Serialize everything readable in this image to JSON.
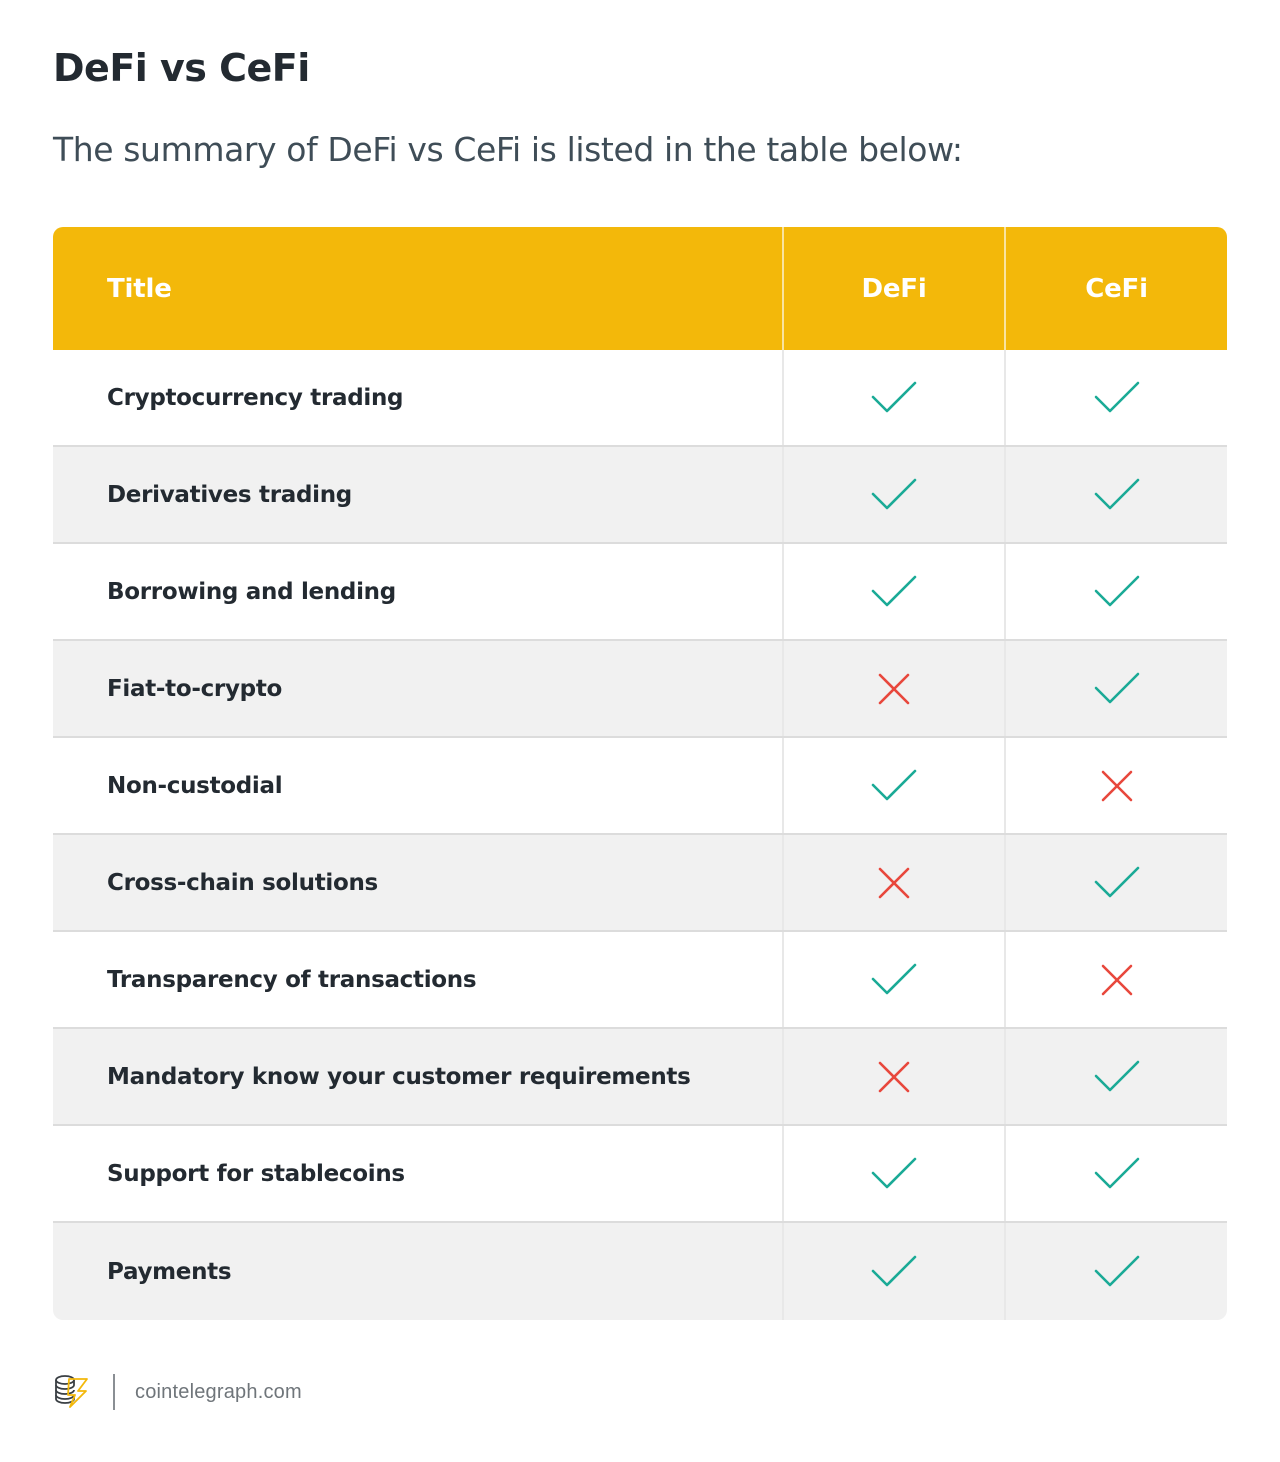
{
  "page": {
    "title": "DeFi vs CeFi",
    "subtitle": "The summary of DeFi vs CeFi is listed in the table below:"
  },
  "table": {
    "header": {
      "title": "Title",
      "defi": "DeFi",
      "cefi": "CeFi"
    },
    "rows": [
      {
        "title": "Cryptocurrency trading",
        "defi": "check",
        "cefi": "check"
      },
      {
        "title": "Derivatives trading",
        "defi": "check",
        "cefi": "check"
      },
      {
        "title": "Borrowing and lending",
        "defi": "check",
        "cefi": "check"
      },
      {
        "title": "Fiat-to-crypto",
        "defi": "cross",
        "cefi": "check"
      },
      {
        "title": "Non-custodial",
        "defi": "check",
        "cefi": "cross"
      },
      {
        "title": "Cross-chain solutions",
        "defi": "cross",
        "cefi": "check"
      },
      {
        "title": "Transparency of transactions",
        "defi": "check",
        "cefi": "cross"
      },
      {
        "title": "Mandatory know your customer requirements",
        "defi": "cross",
        "cefi": "check"
      },
      {
        "title": "Support for stablecoins",
        "defi": "check",
        "cefi": "check"
      },
      {
        "title": "Payments",
        "defi": "check",
        "cefi": "check"
      }
    ]
  },
  "colors": {
    "header_bg": "#f3b80a",
    "check": "#1aaa96",
    "cross": "#e8473c"
  },
  "footer": {
    "logo_icon": "cointelegraph-logo-icon",
    "site": "cointelegraph.com"
  }
}
